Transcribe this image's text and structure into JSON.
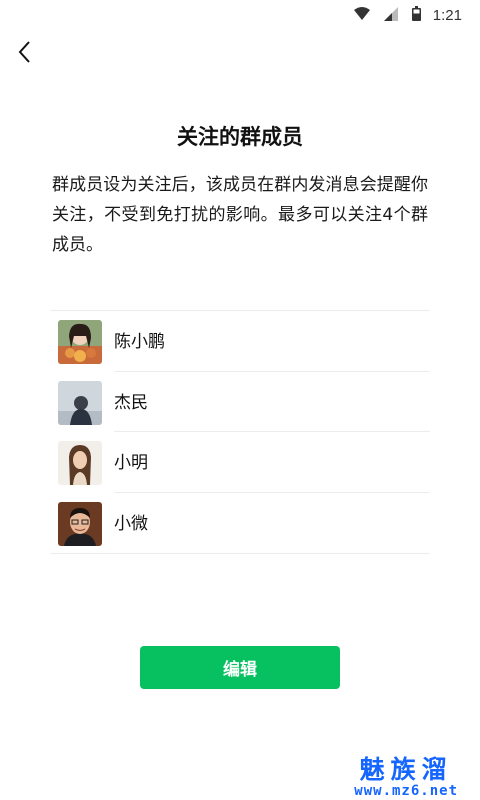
{
  "status_bar": {
    "time": "1:21",
    "icons": [
      "wifi-icon",
      "signal-icon",
      "battery-icon"
    ]
  },
  "nav": {
    "back_icon": "chevron-left-icon"
  },
  "page": {
    "title": "关注的群成员",
    "description": "群成员设为关注后，该成员在群内发消息会提醒你关注，不受到免打扰的影响。最多可以关注4个群成员。"
  },
  "members": [
    {
      "name": "陈小鹏",
      "avatar": "avatar-woman-flowers"
    },
    {
      "name": "杰民",
      "avatar": "avatar-person-back"
    },
    {
      "name": "小明",
      "avatar": "avatar-woman-long-hair"
    },
    {
      "name": "小微",
      "avatar": "avatar-man-glasses"
    }
  ],
  "actions": {
    "edit_label": "编辑"
  },
  "colors": {
    "primary": "#07c160",
    "watermark": "#1565ff"
  },
  "watermark": {
    "brand": "魅族溜",
    "url": "www.mz6.net"
  }
}
